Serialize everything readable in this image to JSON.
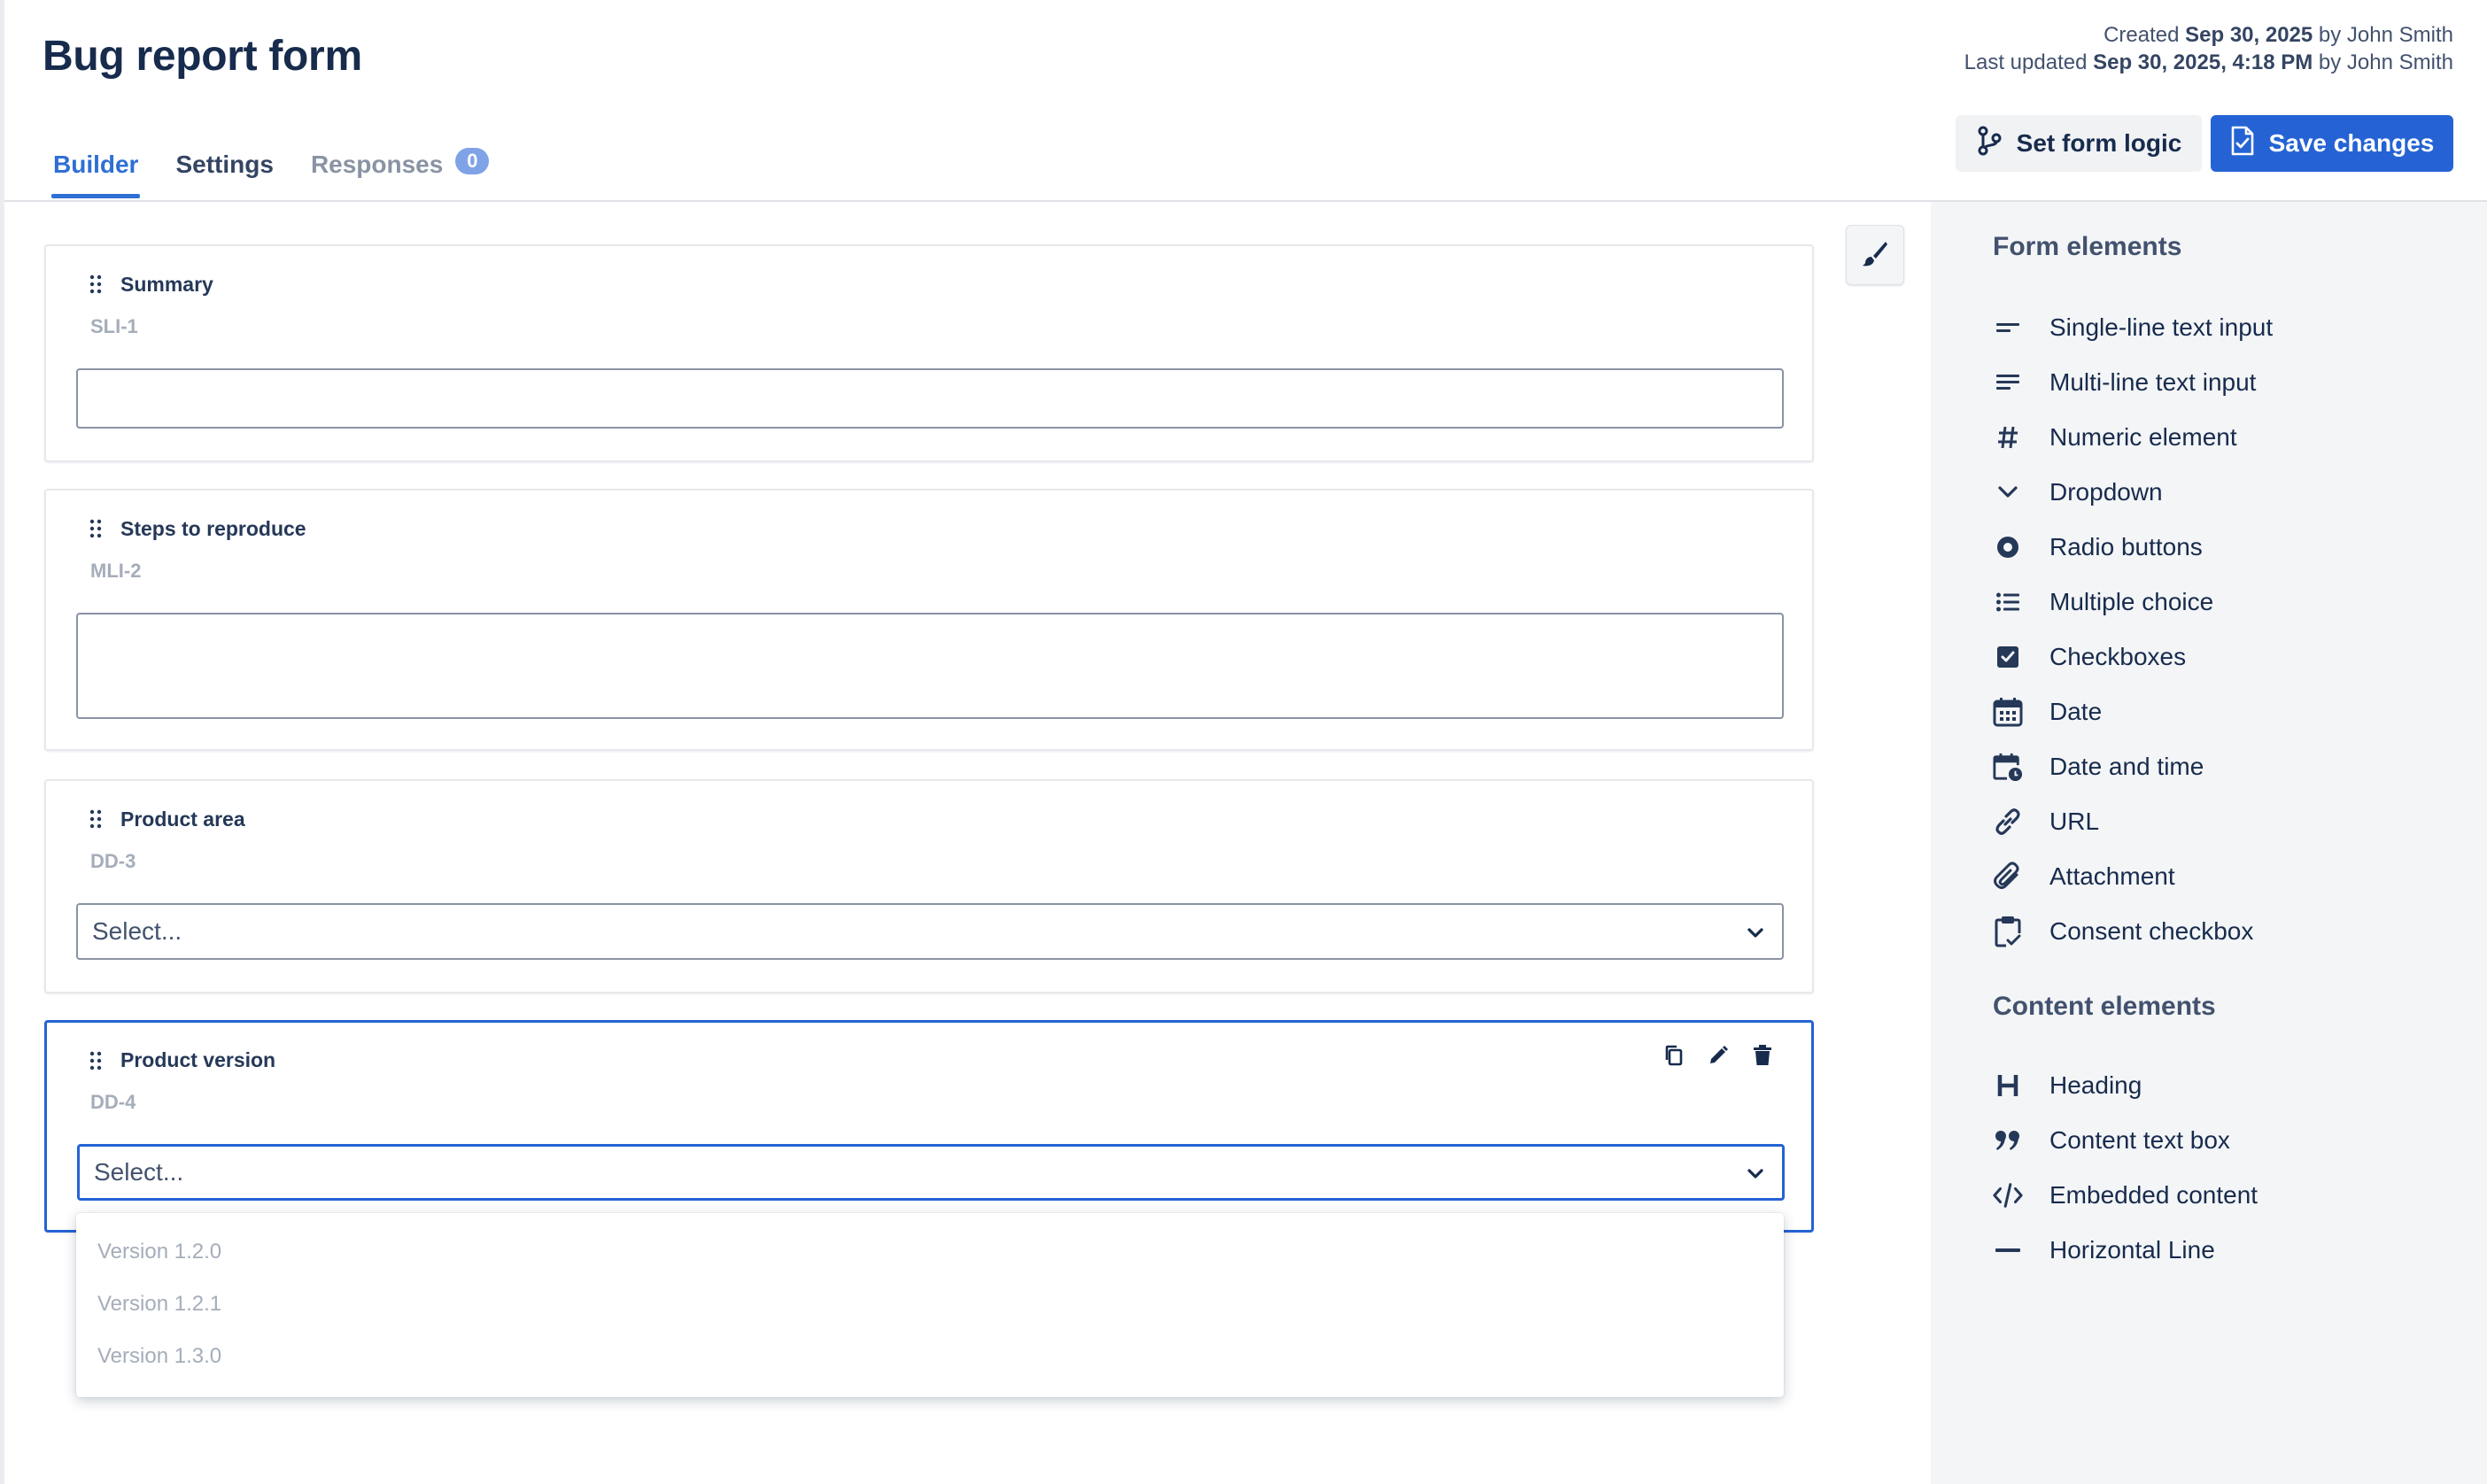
{
  "header": {
    "title": "Bug report form",
    "created_prefix": "Created ",
    "created_date": "Sep 30, 2025",
    "created_suffix": " by John Smith",
    "updated_prefix": "Last updated ",
    "updated_date": "Sep 30, 2025, 4:18 PM",
    "updated_suffix": " by John Smith"
  },
  "tabs": [
    {
      "label": "Builder"
    },
    {
      "label": "Settings"
    },
    {
      "label": "Responses",
      "badge": "0"
    }
  ],
  "buttons": {
    "logic_label": "Set form logic",
    "save_label": "Save changes"
  },
  "fields": [
    {
      "label": "Summary",
      "id": "SLI-1"
    },
    {
      "label": "Steps to reproduce",
      "id": "MLI-2"
    },
    {
      "label": "Product area",
      "id": "DD-3",
      "placeholder": "Select..."
    },
    {
      "label": "Product version",
      "id": "DD-4",
      "placeholder": "Select..."
    }
  ],
  "dropdown_options": [
    "Version 1.2.0",
    "Version 1.2.1",
    "Version 1.3.0"
  ],
  "sidebar": {
    "form_heading": "Form elements",
    "form_items": [
      {
        "label": "Single-line text input",
        "icon": "single-line-icon"
      },
      {
        "label": "Multi-line text input",
        "icon": "multi-line-icon"
      },
      {
        "label": "Numeric element",
        "icon": "hash-icon"
      },
      {
        "label": "Dropdown",
        "icon": "chevron-down-icon"
      },
      {
        "label": "Radio buttons",
        "icon": "radio-icon"
      },
      {
        "label": "Multiple choice",
        "icon": "list-icon"
      },
      {
        "label": "Checkboxes",
        "icon": "checkbox-icon"
      },
      {
        "label": "Date",
        "icon": "calendar-icon"
      },
      {
        "label": "Date and time",
        "icon": "calendar-clock-icon"
      },
      {
        "label": "URL",
        "icon": "link-icon"
      },
      {
        "label": "Attachment",
        "icon": "paperclip-icon"
      },
      {
        "label": "Consent checkbox",
        "icon": "clipboard-check-icon"
      }
    ],
    "content_heading": "Content elements",
    "content_items": [
      {
        "label": "Heading",
        "icon": "heading-icon"
      },
      {
        "label": "Content text box",
        "icon": "quote-icon"
      },
      {
        "label": "Embedded content",
        "icon": "code-icon"
      },
      {
        "label": "Horizontal Line",
        "icon": "horizontal-line-icon"
      }
    ]
  },
  "colors": {
    "accent": "#2563d4",
    "title": "#172b4d",
    "sidebar_bg": "#f4f5f7"
  }
}
